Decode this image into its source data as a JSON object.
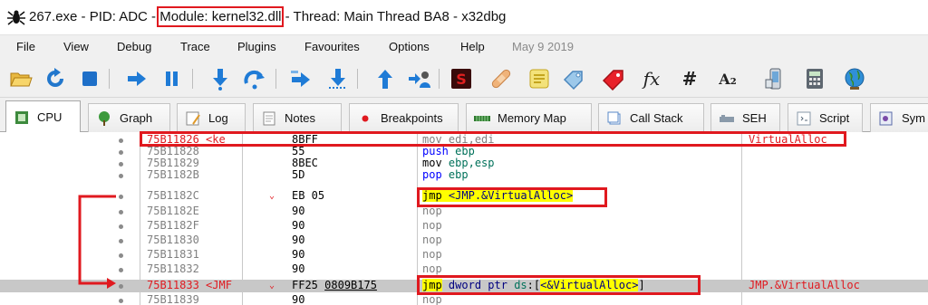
{
  "window": {
    "title_prefix": "267.exe - PID: ADC - ",
    "title_module": "Module: kernel32.dll",
    "title_suffix": " - Thread: Main Thread BA8 - x32dbg",
    "icon": "bug-icon"
  },
  "menu": {
    "items": [
      "File",
      "View",
      "Debug",
      "Trace",
      "Plugins",
      "Favourites",
      "Options",
      "Help"
    ],
    "date": "May 9 2019"
  },
  "toolbar": {
    "icons": [
      "open-icon",
      "restart-icon",
      "stop-icon",
      "run-icon",
      "pause-icon",
      "step-into-icon",
      "step-over-icon",
      "trace-into-icon",
      "trace-over-icon",
      "execute-till-return-icon",
      "run-to-user-code-icon",
      "scylla-icon",
      "patch-icon",
      "comments-icon",
      "labels-icon",
      "bookmarks-icon",
      "functions-icon",
      "variables-icon",
      "strings-icon",
      "device-icon",
      "calculator-icon",
      "globe-icon"
    ],
    "fx_label": "fx",
    "hash_label": "#",
    "az_label": "A₂"
  },
  "tabs": [
    {
      "label": "CPU",
      "icon": "cpu-icon"
    },
    {
      "label": "Graph",
      "icon": "graph-icon"
    },
    {
      "label": "Log",
      "icon": "log-icon"
    },
    {
      "label": "Notes",
      "icon": "notes-icon"
    },
    {
      "label": "Breakpoints",
      "icon": "breakpoint-icon"
    },
    {
      "label": "Memory Map",
      "icon": "memory-map-icon"
    },
    {
      "label": "Call Stack",
      "icon": "call-stack-icon"
    },
    {
      "label": "SEH",
      "icon": "seh-icon"
    },
    {
      "label": "Script",
      "icon": "script-icon"
    },
    {
      "label": "Sym",
      "icon": "symbols-icon"
    }
  ],
  "colors": {
    "annotation_red": "#e0191f",
    "highlight_yellow": "#ffff00",
    "selected_row": "#c8c8c8"
  },
  "disasm": {
    "rows": [
      {
        "addr": "75B11826",
        "label": "<ke",
        "bytes": "8BFF",
        "mnem": "mov",
        "ops": "edi,edi",
        "comment": "VirtualAlloc"
      },
      {
        "addr": "75B11828",
        "bytes": "55",
        "mnem": "push",
        "ops": "ebp"
      },
      {
        "addr": "75B11829",
        "bytes": "8BEC",
        "mnem": "mov",
        "ops": "ebp,esp"
      },
      {
        "addr": "75B1182B",
        "bytes": "5D",
        "mnem": "pop",
        "ops": "ebp"
      },
      {
        "addr": "75B1182C",
        "jump_marker": "⌄",
        "bytes": "EB 05",
        "mnem": "jmp",
        "ops": "<JMP.&VirtualAlloc>"
      },
      {
        "addr": "75B1182E",
        "bytes": "90",
        "mnem": "nop"
      },
      {
        "addr": "75B1182F",
        "bytes": "90",
        "mnem": "nop"
      },
      {
        "addr": "75B11830",
        "bytes": "90",
        "mnem": "nop"
      },
      {
        "addr": "75B11831",
        "bytes": "90",
        "mnem": "nop"
      },
      {
        "addr": "75B11832",
        "bytes": "90",
        "mnem": "nop"
      },
      {
        "addr": "75B11833",
        "label": "<JMF",
        "jump_marker": "⌄",
        "bytes_op": "FF25",
        "bytes_imm": "0809B175",
        "mnem": "jmp",
        "size": "dword ptr",
        "seg": "ds",
        "ops": "<&VirtualAlloc>",
        "comment": "JMP.&VirtualAlloc"
      },
      {
        "addr": "75B11839",
        "bytes": "90",
        "mnem": "nop"
      }
    ]
  }
}
